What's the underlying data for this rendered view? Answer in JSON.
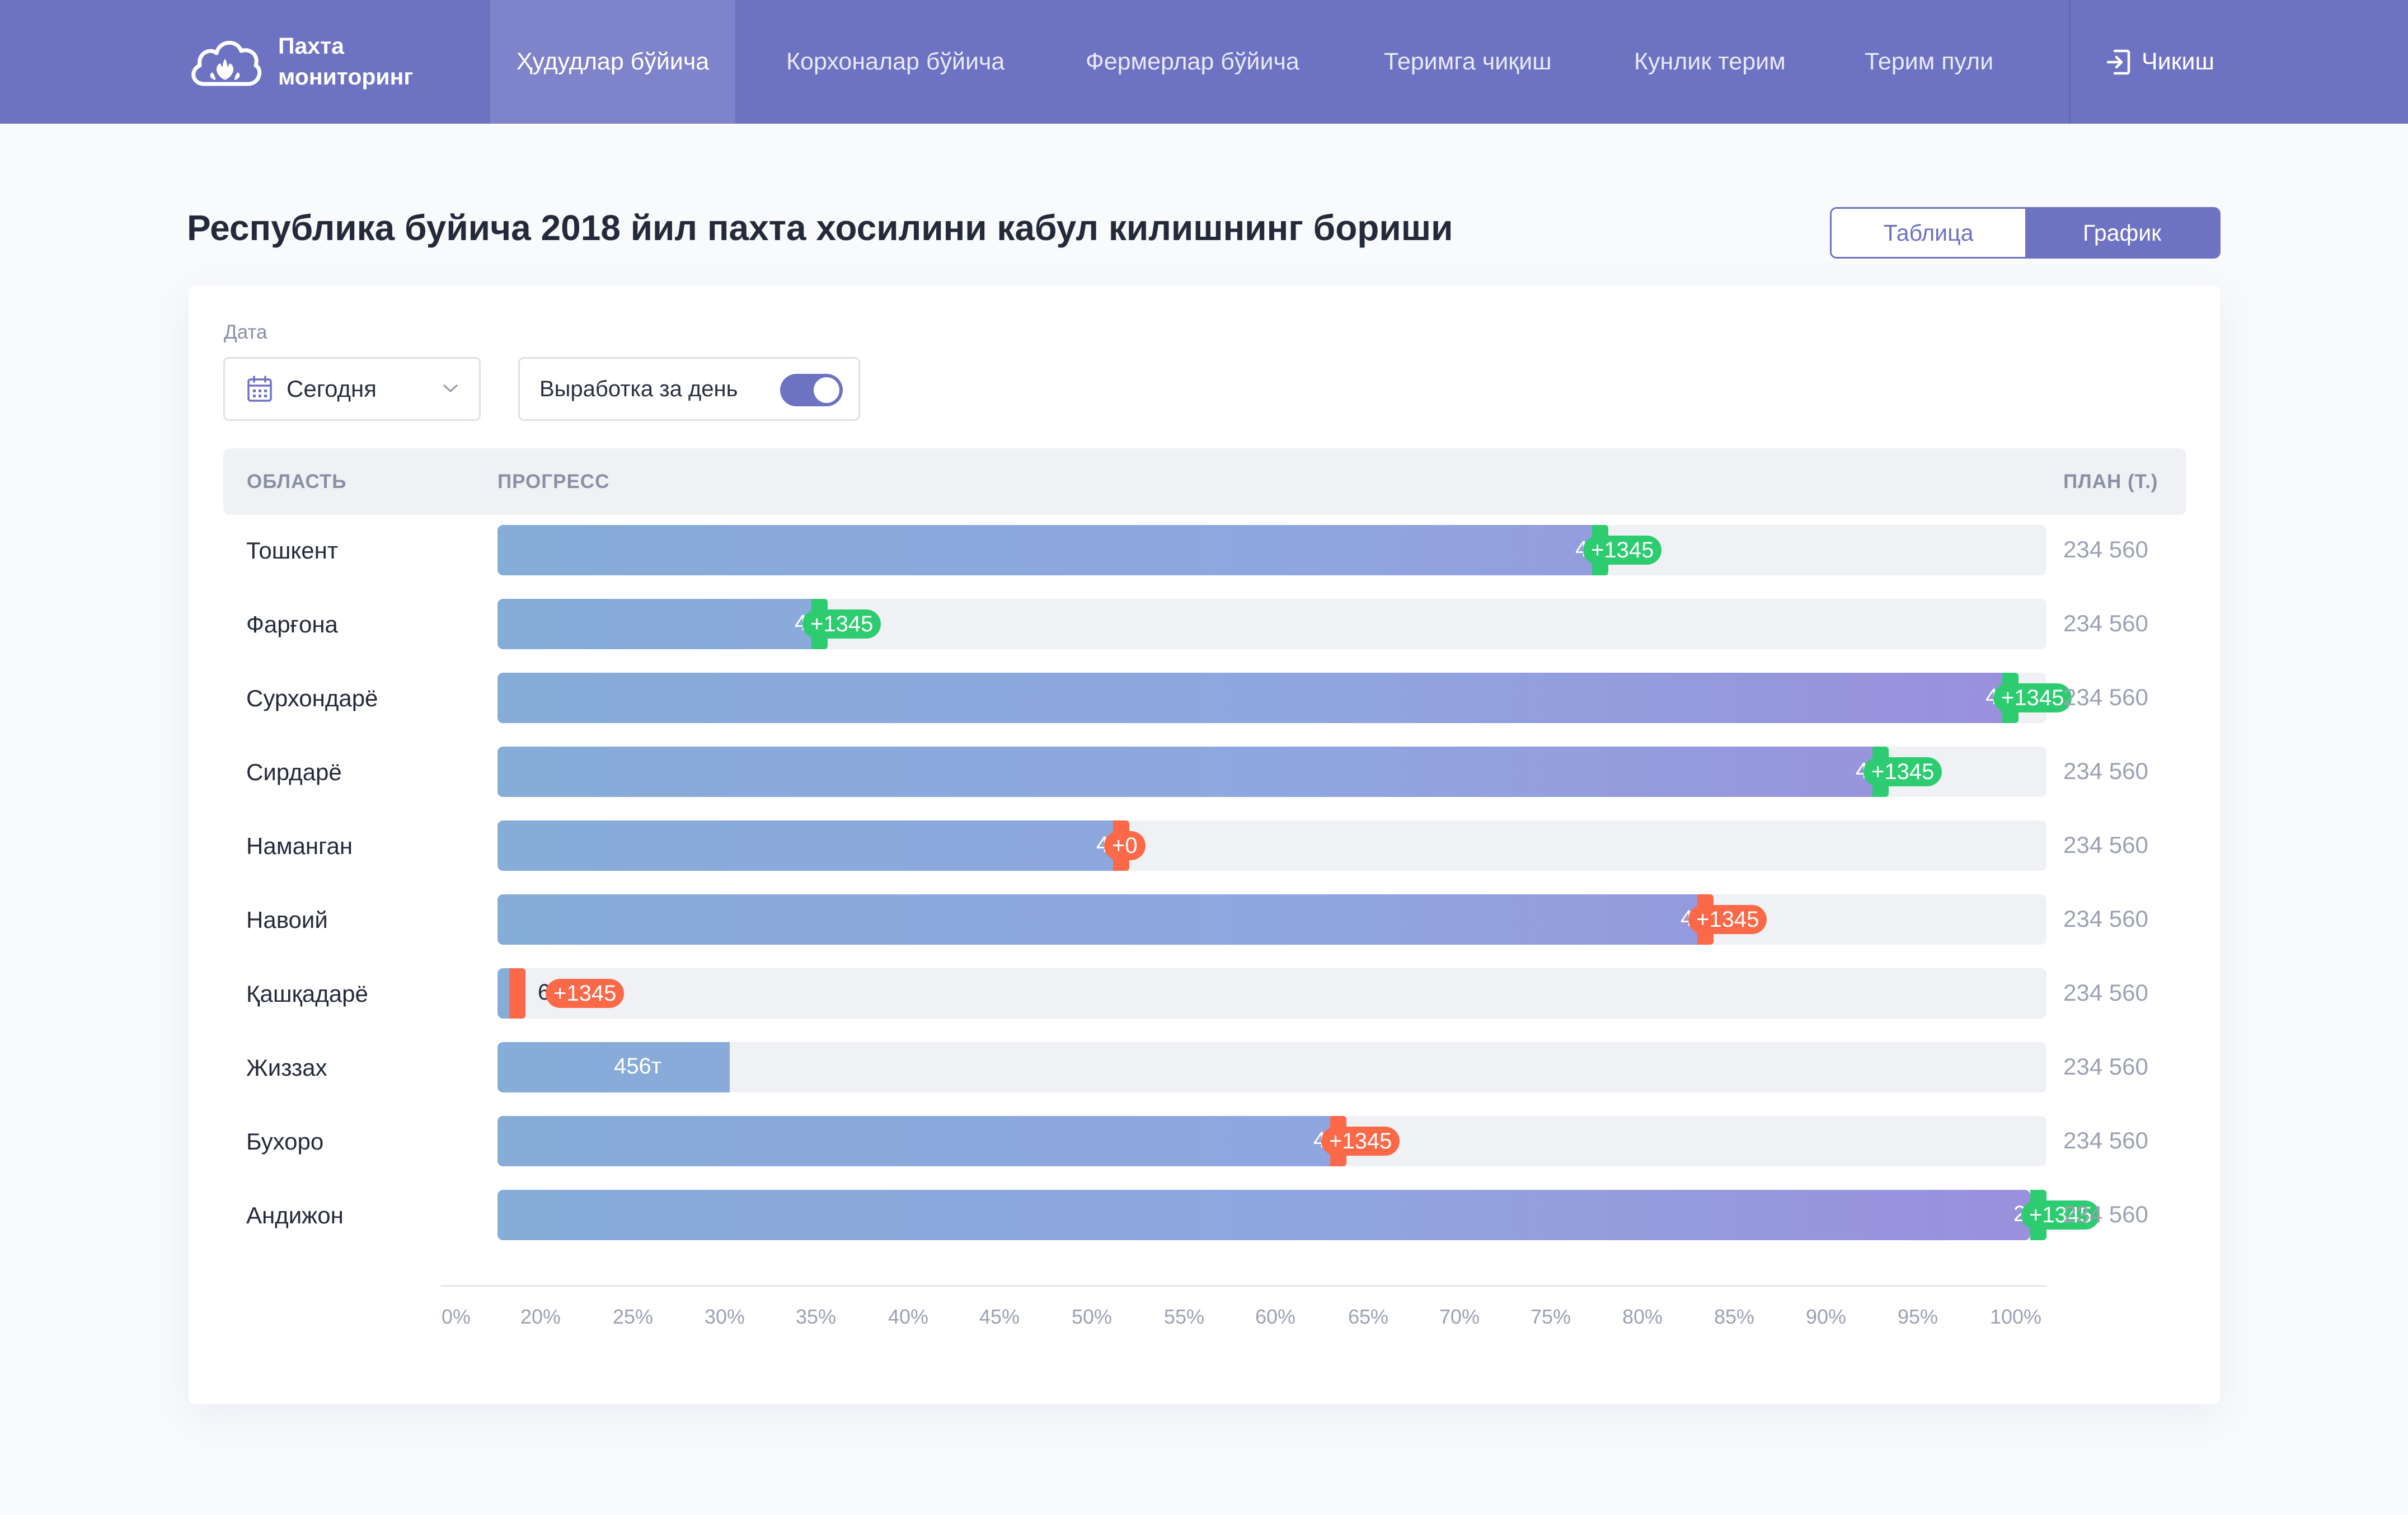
{
  "nav": {
    "logo_text": [
      "Пахта",
      "мониторинг"
    ],
    "items": [
      {
        "label": "Ҳудудлар бўйича",
        "active": true
      },
      {
        "label": "Корхоналар бўйича",
        "active": false
      },
      {
        "label": "Фермерлар бўйича",
        "active": false
      },
      {
        "label": "Теримга чиқиш",
        "active": false
      },
      {
        "label": "Кунлик терим",
        "active": false
      },
      {
        "label": "Терим пули",
        "active": false
      }
    ],
    "logout_label": "Чикиш"
  },
  "page": {
    "title": "Республика буйича 2018 йил пахта хосилини кабул килишнинг бориши",
    "view_toggle": {
      "table": "Таблица",
      "graph": "График",
      "selected": "graph"
    }
  },
  "filters": {
    "date_label": "Дата",
    "date_value": "Сегодня",
    "daily_label": "Выработка за день",
    "daily_enabled": true
  },
  "table": {
    "col_region": "ОБЛАСТЬ",
    "col_progress": "ПРОГРЕСС",
    "col_plan": "ПЛАН (Т.)"
  },
  "colors": {
    "primary": "#6d72c3",
    "increase": "#2ecc71",
    "decrease": "#fb6948",
    "bar_start": "#86acd8",
    "bar_end": "#9a8fdc"
  },
  "chart_data": {
    "type": "bar",
    "orientation": "horizontal",
    "x_ticks": [
      "0%",
      "20%",
      "25%",
      "30%",
      "35%",
      "40%",
      "45%",
      "50%",
      "55%",
      "60%",
      "65%",
      "70%",
      "75%",
      "80%",
      "85%",
      "90%",
      "95%",
      "100%"
    ],
    "rows": [
      {
        "region": "Тошкент",
        "value_label": "456т",
        "delta": "+1345",
        "delta_type": "increase",
        "progress_pct": 71.7,
        "plan": "234 560"
      },
      {
        "region": "Фарғона",
        "value_label": "456т",
        "delta": "+1345",
        "delta_type": "increase",
        "progress_pct": 21.3,
        "plan": "234 560"
      },
      {
        "region": "Сурхондарё",
        "value_label": "456т",
        "delta": "+1345",
        "delta_type": "increase",
        "progress_pct": 98.2,
        "plan": "234 560"
      },
      {
        "region": "Сирдарё",
        "value_label": "456т",
        "delta": "+1345",
        "delta_type": "increase",
        "progress_pct": 89.8,
        "plan": "234 560"
      },
      {
        "region": "Наманган",
        "value_label": "456т",
        "delta": "+0",
        "delta_type": "decrease",
        "progress_pct": 40.8,
        "plan": "234 560"
      },
      {
        "region": "Навоий",
        "value_label": "456т",
        "delta": "+1345",
        "delta_type": "decrease",
        "progress_pct": 78.5,
        "plan": "234 560"
      },
      {
        "region": "Қашқадарё",
        "value_label": "6т",
        "delta": "+1345",
        "delta_type": "decrease",
        "progress_pct": 1.8,
        "plan": "234 560"
      },
      {
        "region": "Жиззах",
        "value_label": "456т",
        "delta": null,
        "delta_type": "none",
        "progress_pct": 15.0,
        "plan": "234 560"
      },
      {
        "region": "Бухоро",
        "value_label": "456т",
        "delta": "+1345",
        "delta_type": "decrease",
        "progress_pct": 54.8,
        "plan": "234 560"
      },
      {
        "region": "Андижон",
        "value_label": "234 560",
        "delta": "+1345",
        "delta_type": "increase",
        "progress_pct": 100,
        "plan": "234 560"
      }
    ]
  }
}
